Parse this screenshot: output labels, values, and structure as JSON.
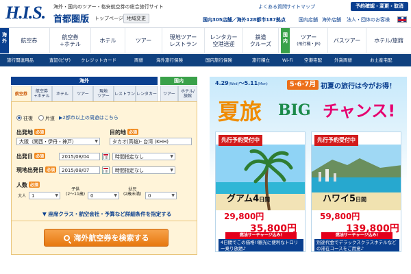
{
  "header": {
    "logo": "H.I.S.",
    "tagline": "海外・国内のツアー・格安航空券の総合旅行サイト",
    "region": "首都圏版",
    "top_page": "トップページ",
    "region_change": "地域変更",
    "faq": "よくある質問",
    "sitemap": "サイトマップ",
    "reserve_button": "予約確認・変更・取消",
    "stores": "国内305店舗／海外128都市187拠点",
    "domestic_stores": "国内店舗",
    "overseas_stores": "海外店舗",
    "corporate": "法人・団体のお客様"
  },
  "nav": {
    "side_overseas": "海外",
    "side_domestic": "国内",
    "overseas": [
      {
        "label": "航空券",
        "sub": ""
      },
      {
        "label": "航空券",
        "sub": "+ホテル"
      },
      {
        "label": "ホテル",
        "sub": ""
      },
      {
        "label": "ツアー",
        "sub": ""
      },
      {
        "label": "現地ツアー",
        "sub": "レストラン"
      },
      {
        "label": "レンタカー",
        "sub": "空港送迎"
      },
      {
        "label": "鉄道",
        "sub": "クルーズ"
      }
    ],
    "domestic": [
      {
        "label": "ツアー",
        "sub": "(飛行機・JR)"
      },
      {
        "label": "バスツアー",
        "sub": ""
      },
      {
        "label": "ホテル/旅館",
        "sub": ""
      }
    ]
  },
  "subnav": [
    "旅行関連用品",
    "査証(ビザ)",
    "クレジットカード",
    "両替",
    "海外旅行保険",
    "国内旅行保険",
    "旅行積立",
    "Wi-Fi",
    "空港宅配",
    "外貨両替",
    "お土産宅配"
  ],
  "search": {
    "tab_overseas": "海外",
    "tab_domestic": "国内",
    "tabs": [
      {
        "label": "航空券",
        "active": true
      },
      {
        "label": "航空券\n+ホテル",
        "active": false
      },
      {
        "label": "ホテル",
        "active": false
      },
      {
        "label": "ツアー",
        "active": false
      },
      {
        "label": "現地\nツアー",
        "active": false
      },
      {
        "label": "レストラン",
        "active": false
      },
      {
        "label": "レンタカー",
        "active": false
      },
      {
        "label": "ツアー",
        "active": false
      },
      {
        "label": "ホテル/旅館",
        "active": false
      }
    ],
    "round_trip": "往復",
    "one_way": "片道",
    "multi_city": "2都市以上の周遊はこちら",
    "required": "必須",
    "departure_label": "出発地",
    "departure_value": "大阪（関西・伊丹・神戸）",
    "destination_label": "目的地",
    "destination_value": "タカオ(高雄)- 台湾 (KHH)",
    "depart_date_label": "出発日",
    "depart_date": "2015/08/04",
    "depart_time": "時間指定なし",
    "return_date_label": "現地出発日",
    "return_date": "2015/08/07",
    "return_time": "時間指定なし",
    "pax_label": "人数",
    "adult_label": "大人",
    "adult_value": "1",
    "child_label": "子供\n(2～11歳)",
    "child_value": "0",
    "infant_label": "幼児\n(2歳未満)",
    "infant_value": "0",
    "detail_link": "座席クラス・航空会社・予算など詳細条件を指定する",
    "search_button": "海外航空券を検索する"
  },
  "banner": {
    "dates": "4.29",
    "dates_dow1": "(Wed)",
    "dates_sep": "～",
    "dates_end": "5.11",
    "dates_dow2": "(Mon)",
    "months": "5·6·7月",
    "headline": "初夏の旅行は今がお得！",
    "natsu": "夏旅",
    "big": "BIG",
    "chance": "チャンス!",
    "cards": [
      {
        "ribbon": "先行予約受付中",
        "dest": "グアム4",
        "dest_unit": "日間",
        "price_from": "29,800円",
        "price_to": "35,800円",
        "fuel": "燃油サーチャージ込み!",
        "note": "4日間でこの価格!!観光に便利なトロリー乗り放題♪"
      },
      {
        "ribbon": "先行予約受付中",
        "dest": "ハワイ5",
        "dest_unit": "日間",
        "price_from": "59,800円",
        "price_to": "139,800円",
        "fuel": "燃油サーチャージ込み!",
        "note": "別途代金でデラックスクラスホテルなどの滞在コースをご用意♪"
      }
    ]
  },
  "colors": {
    "brand": "#0a3f8f",
    "accent": "#e7780f",
    "domestic": "#3aa14a"
  }
}
